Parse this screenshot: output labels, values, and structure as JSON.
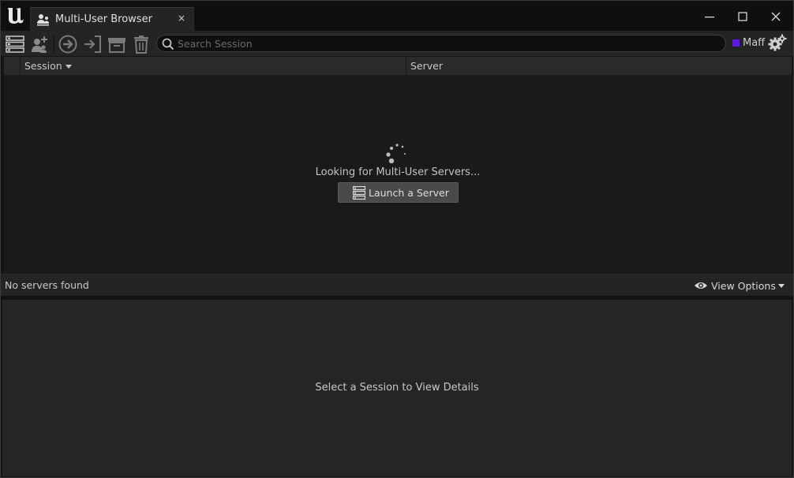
{
  "window": {
    "tab_title": "Multi-User Browser",
    "tab_close": "×"
  },
  "toolbar": {
    "search_placeholder": "Search Session",
    "user_name": "Maff",
    "user_color": "#5a1cdc",
    "icons": [
      "server-list-icon",
      "add-user-icon",
      "join-session-icon",
      "enter-session-icon",
      "archive-icon",
      "delete-icon",
      "gear-icon"
    ]
  },
  "table": {
    "columns": [
      "Session",
      "Server"
    ],
    "sorted_column": "Session"
  },
  "list": {
    "loading_text": "Looking for Multi-User Servers...",
    "launch_button": "Launch a Server"
  },
  "status": {
    "text": "No servers found",
    "view_options": "View Options"
  },
  "details": {
    "placeholder": "Select a Session to View Details"
  }
}
